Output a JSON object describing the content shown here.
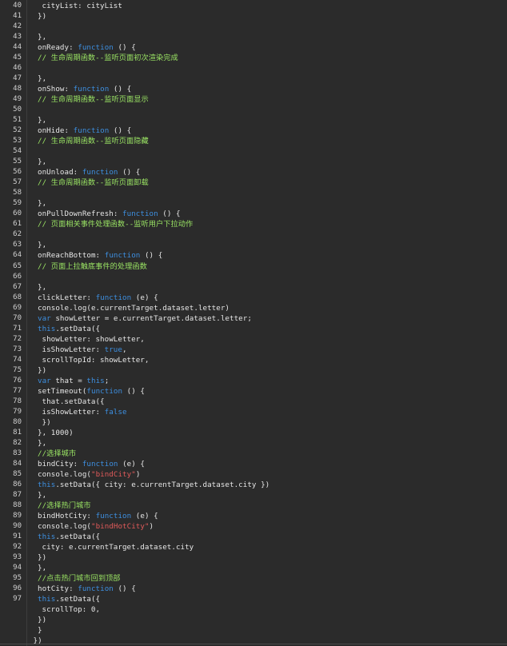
{
  "editor": {
    "colors": {
      "background": "#2b2b2b",
      "keyword": "#3d8fe0",
      "string": "#e05a5a",
      "comment": "#9be564",
      "text": "#e6e6e6",
      "line_number": "#cfcfcf"
    },
    "lines": [
      {
        "n": "40",
        "indent": 1,
        "tokens": [
          {
            "t": "pl",
            "v": "cityList: cityList"
          }
        ]
      },
      {
        "n": "41",
        "indent": 0,
        "tokens": [
          {
            "t": "pl",
            "v": "})"
          }
        ]
      },
      {
        "n": "42",
        "indent": 0,
        "tokens": []
      },
      {
        "n": "43",
        "indent": 0,
        "tokens": [
          {
            "t": "pl",
            "v": "},"
          }
        ]
      },
      {
        "n": "44",
        "indent": 0,
        "tokens": [
          {
            "t": "pl",
            "v": "onReady: "
          },
          {
            "t": "kw",
            "v": "function"
          },
          {
            "t": "pl",
            "v": " () {"
          }
        ]
      },
      {
        "n": "45",
        "indent": 0,
        "tokens": [
          {
            "t": "cm",
            "v": "// 生命周期函数--监听页面初次渲染完成"
          }
        ]
      },
      {
        "n": "46",
        "indent": 0,
        "tokens": []
      },
      {
        "n": "47",
        "indent": 0,
        "tokens": [
          {
            "t": "pl",
            "v": "},"
          }
        ]
      },
      {
        "n": "48",
        "indent": 0,
        "tokens": [
          {
            "t": "pl",
            "v": "onShow: "
          },
          {
            "t": "kw",
            "v": "function"
          },
          {
            "t": "pl",
            "v": " () {"
          }
        ]
      },
      {
        "n": "49",
        "indent": 0,
        "tokens": [
          {
            "t": "cm",
            "v": "// 生命周期函数--监听页面显示"
          }
        ]
      },
      {
        "n": "50",
        "indent": 0,
        "tokens": []
      },
      {
        "n": "51",
        "indent": 0,
        "tokens": [
          {
            "t": "pl",
            "v": "},"
          }
        ]
      },
      {
        "n": "52",
        "indent": 0,
        "tokens": [
          {
            "t": "pl",
            "v": "onHide: "
          },
          {
            "t": "kw",
            "v": "function"
          },
          {
            "t": "pl",
            "v": " () {"
          }
        ]
      },
      {
        "n": "53",
        "indent": 0,
        "tokens": [
          {
            "t": "cm",
            "v": "// 生命周期函数--监听页面隐藏"
          }
        ]
      },
      {
        "n": "54",
        "indent": 0,
        "tokens": []
      },
      {
        "n": "55",
        "indent": 0,
        "tokens": [
          {
            "t": "pl",
            "v": "},"
          }
        ]
      },
      {
        "n": "56",
        "indent": 0,
        "tokens": [
          {
            "t": "pl",
            "v": "onUnload: "
          },
          {
            "t": "kw",
            "v": "function"
          },
          {
            "t": "pl",
            "v": " () {"
          }
        ]
      },
      {
        "n": "57",
        "indent": 0,
        "tokens": [
          {
            "t": "cm",
            "v": "// 生命周期函数--监听页面卸载"
          }
        ]
      },
      {
        "n": "58",
        "indent": 0,
        "tokens": []
      },
      {
        "n": "59",
        "indent": 0,
        "tokens": [
          {
            "t": "pl",
            "v": "},"
          }
        ]
      },
      {
        "n": "60",
        "indent": 0,
        "tokens": [
          {
            "t": "pl",
            "v": "onPullDownRefresh: "
          },
          {
            "t": "kw",
            "v": "function"
          },
          {
            "t": "pl",
            "v": " () {"
          }
        ]
      },
      {
        "n": "61",
        "indent": 0,
        "tokens": [
          {
            "t": "cm",
            "v": "// 页面相关事件处理函数--监听用户下拉动作"
          }
        ]
      },
      {
        "n": "62",
        "indent": 0,
        "tokens": []
      },
      {
        "n": "63",
        "indent": 0,
        "tokens": [
          {
            "t": "pl",
            "v": "},"
          }
        ]
      },
      {
        "n": "64",
        "indent": 0,
        "tokens": [
          {
            "t": "pl",
            "v": "onReachBottom: "
          },
          {
            "t": "kw",
            "v": "function"
          },
          {
            "t": "pl",
            "v": " () {"
          }
        ]
      },
      {
        "n": "65",
        "indent": 0,
        "tokens": [
          {
            "t": "cm",
            "v": "// 页面上拉触底事件的处理函数"
          }
        ]
      },
      {
        "n": "66",
        "indent": 0,
        "tokens": []
      },
      {
        "n": "67",
        "indent": 0,
        "tokens": [
          {
            "t": "pl",
            "v": "},"
          }
        ]
      },
      {
        "n": "68",
        "indent": 0,
        "tokens": [
          {
            "t": "pl",
            "v": "clickLetter: "
          },
          {
            "t": "kw",
            "v": "function"
          },
          {
            "t": "pl",
            "v": " (e) {"
          }
        ]
      },
      {
        "n": "69",
        "indent": 0,
        "tokens": [
          {
            "t": "pl",
            "v": "console.log(e.currentTarget.dataset.letter)"
          }
        ]
      },
      {
        "n": "70",
        "indent": 0,
        "tokens": [
          {
            "t": "kw",
            "v": "var"
          },
          {
            "t": "pl",
            "v": " showLetter = e.currentTarget.dataset.letter;"
          }
        ]
      },
      {
        "n": "71",
        "indent": 0,
        "tokens": [
          {
            "t": "kw",
            "v": "this"
          },
          {
            "t": "pl",
            "v": ".setData({"
          }
        ]
      },
      {
        "n": "72",
        "indent": 1,
        "tokens": [
          {
            "t": "pl",
            "v": "showLetter: showLetter,"
          }
        ]
      },
      {
        "n": "73",
        "indent": 1,
        "tokens": [
          {
            "t": "pl",
            "v": "isShowLetter: "
          },
          {
            "t": "kw",
            "v": "true"
          },
          {
            "t": "pl",
            "v": ","
          }
        ]
      },
      {
        "n": "74",
        "indent": 1,
        "tokens": [
          {
            "t": "pl",
            "v": "scrollTopId: showLetter,"
          }
        ]
      },
      {
        "n": "75",
        "indent": 0,
        "tokens": [
          {
            "t": "pl",
            "v": "})"
          }
        ]
      },
      {
        "n": "76",
        "indent": 0,
        "tokens": [
          {
            "t": "kw",
            "v": "var"
          },
          {
            "t": "pl",
            "v": " that = "
          },
          {
            "t": "kw",
            "v": "this"
          },
          {
            "t": "pl",
            "v": ";"
          }
        ]
      },
      {
        "n": "77",
        "indent": 0,
        "tokens": [
          {
            "t": "pl",
            "v": "setTimeout("
          },
          {
            "t": "kw",
            "v": "function"
          },
          {
            "t": "pl",
            "v": " () {"
          }
        ]
      },
      {
        "n": "78",
        "indent": 1,
        "tokens": [
          {
            "t": "pl",
            "v": "that.setData({"
          }
        ]
      },
      {
        "n": "79",
        "indent": 1,
        "tokens": [
          {
            "t": "pl",
            "v": "isShowLetter: "
          },
          {
            "t": "kw",
            "v": "false"
          }
        ]
      },
      {
        "n": "80",
        "indent": 1,
        "tokens": [
          {
            "t": "pl",
            "v": "})"
          }
        ]
      },
      {
        "n": "81",
        "indent": 0,
        "tokens": [
          {
            "t": "pl",
            "v": "}, 1000)"
          }
        ]
      },
      {
        "n": "82",
        "indent": 0,
        "tokens": [
          {
            "t": "pl",
            "v": "},"
          }
        ]
      },
      {
        "n": "83",
        "indent": 0,
        "tokens": [
          {
            "t": "cm",
            "v": "//选择城市"
          }
        ]
      },
      {
        "n": "84",
        "indent": 0,
        "tokens": [
          {
            "t": "pl",
            "v": "bindCity: "
          },
          {
            "t": "kw",
            "v": "function"
          },
          {
            "t": "pl",
            "v": " (e) {"
          }
        ]
      },
      {
        "n": "85",
        "indent": 0,
        "tokens": [
          {
            "t": "pl",
            "v": "console.log("
          },
          {
            "t": "str",
            "v": "\"bindCity\""
          },
          {
            "t": "pl",
            "v": ")"
          }
        ]
      },
      {
        "n": "86",
        "indent": 0,
        "tokens": [
          {
            "t": "kw",
            "v": "this"
          },
          {
            "t": "pl",
            "v": ".setData({ city: e.currentTarget.dataset.city })"
          }
        ]
      },
      {
        "n": "87",
        "indent": 0,
        "tokens": [
          {
            "t": "pl",
            "v": "},"
          }
        ]
      },
      {
        "n": "88",
        "indent": 0,
        "tokens": [
          {
            "t": "cm",
            "v": "//选择热门城市"
          }
        ]
      },
      {
        "n": "89",
        "indent": 0,
        "tokens": [
          {
            "t": "pl",
            "v": "bindHotCity: "
          },
          {
            "t": "kw",
            "v": "function"
          },
          {
            "t": "pl",
            "v": " (e) {"
          }
        ]
      },
      {
        "n": "90",
        "indent": 0,
        "tokens": [
          {
            "t": "pl",
            "v": "console.log("
          },
          {
            "t": "str",
            "v": "\"bindHotCity\""
          },
          {
            "t": "pl",
            "v": ")"
          }
        ]
      },
      {
        "n": "91",
        "indent": 0,
        "tokens": [
          {
            "t": "kw",
            "v": "this"
          },
          {
            "t": "pl",
            "v": ".setData({"
          }
        ]
      },
      {
        "n": "92",
        "indent": 1,
        "tokens": [
          {
            "t": "pl",
            "v": "city: e.currentTarget.dataset.city"
          }
        ]
      },
      {
        "n": "93",
        "indent": 0,
        "tokens": [
          {
            "t": "pl",
            "v": "})"
          }
        ]
      },
      {
        "n": "94",
        "indent": 0,
        "tokens": [
          {
            "t": "pl",
            "v": "},"
          }
        ]
      },
      {
        "n": "95",
        "indent": 0,
        "tokens": [
          {
            "t": "cm",
            "v": "//点击热门城市回到顶部"
          }
        ]
      },
      {
        "n": "96",
        "indent": 0,
        "tokens": [
          {
            "t": "pl",
            "v": "hotCity: "
          },
          {
            "t": "kw",
            "v": "function"
          },
          {
            "t": "pl",
            "v": " () {"
          }
        ]
      },
      {
        "n": "97",
        "indent": 0,
        "tokens": [
          {
            "t": "kw",
            "v": "this"
          },
          {
            "t": "pl",
            "v": ".setData({"
          }
        ]
      },
      {
        "n": "",
        "indent": 1,
        "tokens": [
          {
            "t": "pl",
            "v": "scrollTop: 0,"
          }
        ]
      },
      {
        "n": "",
        "indent": 0,
        "tokens": [
          {
            "t": "pl",
            "v": "})"
          }
        ]
      },
      {
        "n": "",
        "indent": 0,
        "tokens": [
          {
            "t": "pl",
            "v": "}"
          }
        ]
      },
      {
        "n": "",
        "indent": -1,
        "tokens": [
          {
            "t": "pl",
            "v": "})"
          }
        ]
      }
    ]
  }
}
